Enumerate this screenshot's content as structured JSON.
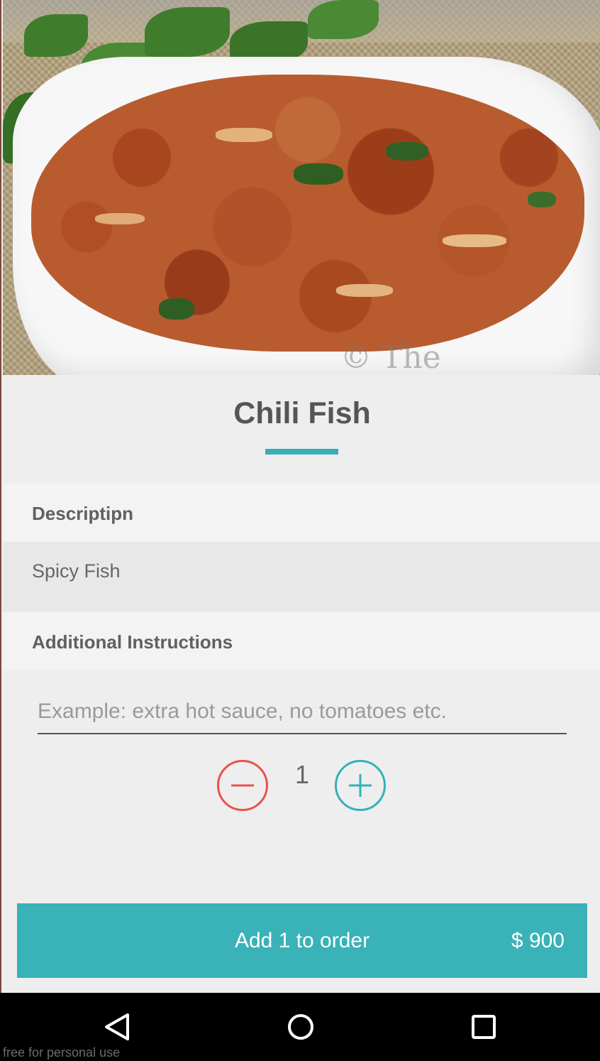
{
  "product": {
    "name": "Chili Fish",
    "image_watermark": "© The"
  },
  "description": {
    "header": "Descriptipn",
    "text": "Spicy Fish"
  },
  "instructions": {
    "header": "Additional Instructions",
    "placeholder": "Example: extra hot sauce, no tomatoes etc.",
    "value": ""
  },
  "quantity": {
    "value": "1",
    "decrement_icon": "minus-circle-icon",
    "increment_icon": "plus-circle-icon"
  },
  "order": {
    "label": "Add 1 to order",
    "price": "$ 900"
  },
  "nav": {
    "back_icon": "back-triangle-icon",
    "home_icon": "home-circle-icon",
    "recents_icon": "recents-square-icon"
  },
  "footer_note": "free for personal use",
  "colors": {
    "accent": "#39b2b8",
    "decrement": "#e8534a",
    "background": "#eeeeee",
    "text": "#555555"
  }
}
